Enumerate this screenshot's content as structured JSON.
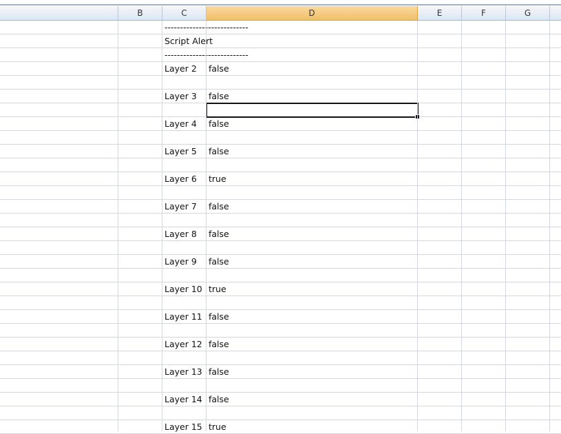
{
  "columns": [
    "",
    "B",
    "C",
    "D",
    "E",
    "F",
    "G",
    ""
  ],
  "selected_column": "D",
  "rows": [
    {
      "c": "---------------------------",
      "d": ""
    },
    {
      "c": "Script Alert",
      "d": ""
    },
    {
      "c": "---------------------------",
      "d": ""
    },
    {
      "c": "Layer 2",
      "d": "false"
    },
    {
      "c": "",
      "d": ""
    },
    {
      "c": "Layer 3",
      "d": "false"
    },
    {
      "c": "",
      "d": ""
    },
    {
      "c": "Layer 4",
      "d": "false"
    },
    {
      "c": "",
      "d": ""
    },
    {
      "c": "Layer 5",
      "d": "false"
    },
    {
      "c": "",
      "d": ""
    },
    {
      "c": "Layer 6",
      "d": "true"
    },
    {
      "c": "",
      "d": ""
    },
    {
      "c": "Layer 7",
      "d": "false"
    },
    {
      "c": "",
      "d": ""
    },
    {
      "c": "Layer 8",
      "d": "false"
    },
    {
      "c": "",
      "d": ""
    },
    {
      "c": "Layer 9",
      "d": "false"
    },
    {
      "c": "",
      "d": ""
    },
    {
      "c": "Layer 10",
      "d": "true"
    },
    {
      "c": "",
      "d": ""
    },
    {
      "c": "Layer 11",
      "d": "false"
    },
    {
      "c": "",
      "d": ""
    },
    {
      "c": "Layer 12",
      "d": "false"
    },
    {
      "c": "",
      "d": ""
    },
    {
      "c": "Layer 13",
      "d": "false"
    },
    {
      "c": "",
      "d": ""
    },
    {
      "c": "Layer 14",
      "d": "false"
    },
    {
      "c": "",
      "d": ""
    },
    {
      "c": "Layer 15",
      "d": "true"
    }
  ]
}
